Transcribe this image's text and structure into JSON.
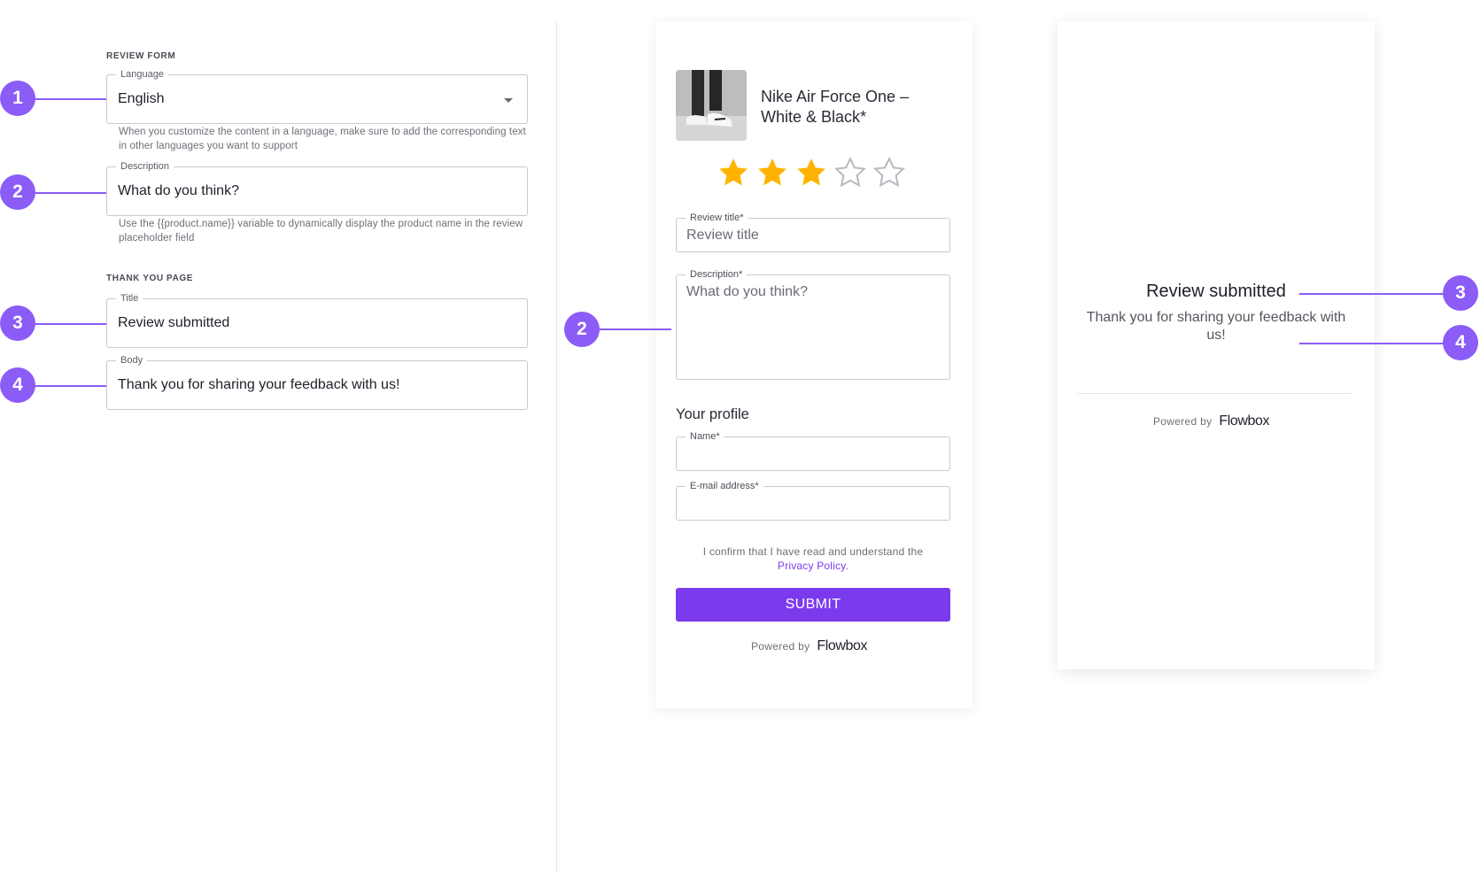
{
  "settings": {
    "review_form_heading": "REVIEW FORM",
    "language": {
      "label": "Language",
      "value": "English",
      "helper": "When you customize the content in a language, make sure to add the corresponding text in other languages you want to support"
    },
    "description": {
      "label": "Description",
      "value": "What do you think?",
      "helper": "Use the {{product.name}} variable to dynamically display the product name in the review placeholder field"
    },
    "thank_you_heading": "THANK YOU PAGE",
    "title": {
      "label": "Title",
      "value": "Review submitted"
    },
    "body": {
      "label": "Body",
      "value": "Thank you for sharing your feedback with us!"
    }
  },
  "callouts": [
    "1",
    "2",
    "3",
    "4"
  ],
  "form_preview": {
    "product_name": "Nike Air Force One – White & Black*",
    "rating": {
      "value": 3,
      "max": 5
    },
    "review_title": {
      "label": "Review title*",
      "placeholder": "Review title"
    },
    "description": {
      "label": "Description*",
      "placeholder": "What do you think?"
    },
    "profile_heading": "Your profile",
    "name": {
      "label": "Name*"
    },
    "email": {
      "label": "E-mail address*"
    },
    "consent_text": "I confirm that I have read and understand the",
    "consent_link": "Privacy Policy",
    "consent_end": ".",
    "submit_label": "SUBMIT",
    "powered_by": "Powered by",
    "brand": "Flowbox"
  },
  "thank_you_preview": {
    "title": "Review submitted",
    "body": "Thank you for sharing your feedback with us!",
    "powered_by": "Powered by",
    "brand": "Flowbox"
  },
  "colors": {
    "accent": "#7c3aed",
    "callout": "#8b5cf6",
    "star_filled": "#ffb300",
    "star_empty": "#b8b8c0"
  }
}
